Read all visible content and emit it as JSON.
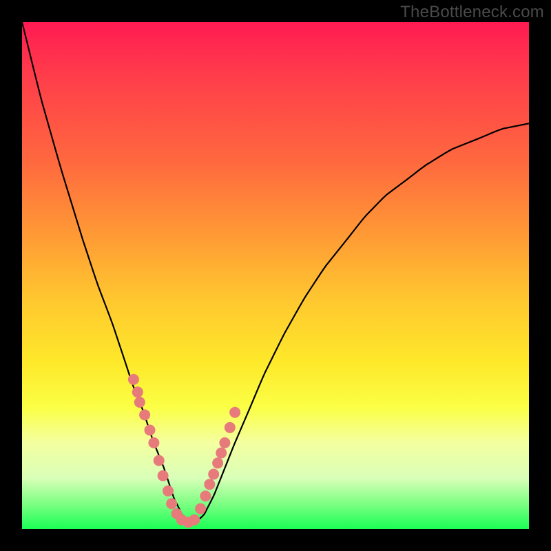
{
  "watermark": "TheBottleneck.com",
  "chart_data": {
    "type": "line",
    "title": "",
    "xlabel": "",
    "ylabel": "",
    "xlim": [
      0,
      100
    ],
    "ylim": [
      0,
      100
    ],
    "series": [
      {
        "name": "curve",
        "x": [
          0,
          4,
          8,
          12,
          15,
          18,
          20,
          22,
          24,
          26,
          28,
          29,
          30,
          31,
          32,
          33,
          34,
          36,
          38,
          40,
          42,
          45,
          48,
          52,
          56,
          60,
          64,
          68,
          72,
          76,
          80,
          85,
          90,
          95,
          100
        ],
        "y": [
          100,
          84,
          70,
          57,
          48,
          40,
          34,
          28,
          23,
          17,
          12,
          9,
          6,
          4,
          2,
          1.2,
          1.2,
          3,
          7,
          12,
          17,
          24,
          31,
          39,
          46,
          52,
          57,
          62,
          66,
          69,
          72,
          75,
          77,
          79,
          80
        ]
      }
    ],
    "scatter_points": {
      "name": "dots",
      "x": [
        22.0,
        22.8,
        23.2,
        24.2,
        25.2,
        26.0,
        27.0,
        27.8,
        28.8,
        29.5,
        30.5,
        31.5,
        32.8,
        34.0,
        35.2,
        36.2,
        37.0,
        37.8,
        38.6,
        39.3,
        40.0,
        41.0,
        42.0
      ],
      "y": [
        29.5,
        27.0,
        25.0,
        22.5,
        19.5,
        17.0,
        13.5,
        10.5,
        7.5,
        5.0,
        3.0,
        1.8,
        1.3,
        1.8,
        4.0,
        6.5,
        8.8,
        10.8,
        13.0,
        15.0,
        17.0,
        20.0,
        23.0
      ]
    },
    "background_gradient": {
      "top": "#ff1a52",
      "mid1": "#ff9a35",
      "mid2": "#fee82a",
      "bottom": "#1aff55"
    }
  }
}
